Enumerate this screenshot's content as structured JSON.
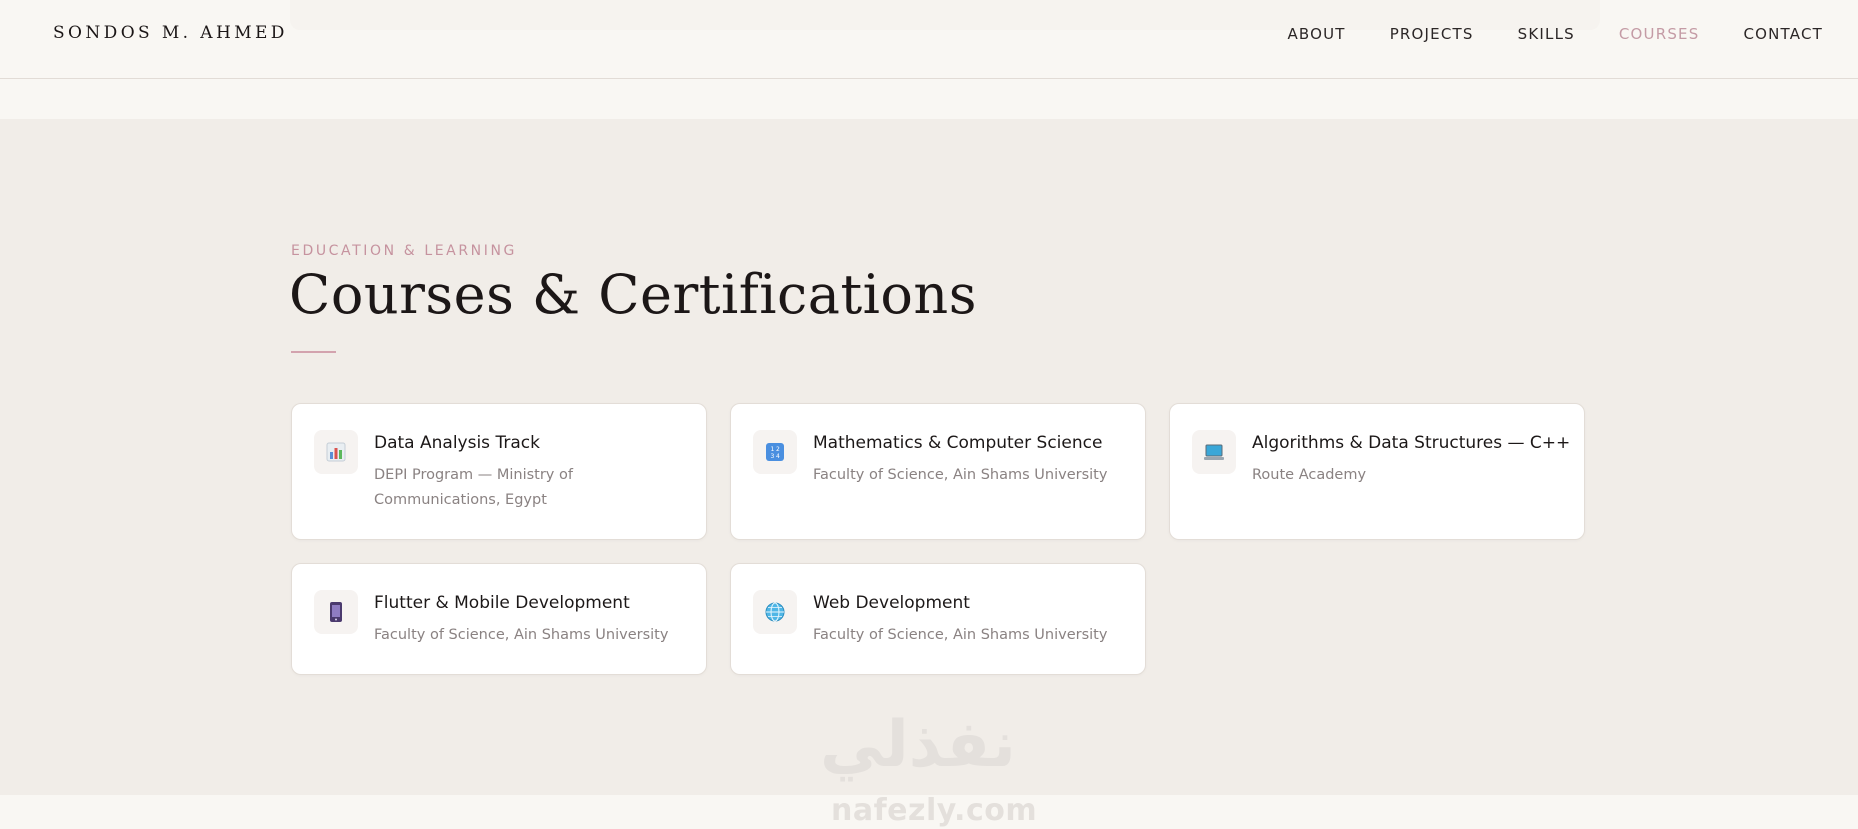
{
  "header": {
    "brand": "SONDOS M. AHMED",
    "nav": [
      {
        "label": "ABOUT",
        "active": false
      },
      {
        "label": "PROJECTS",
        "active": false
      },
      {
        "label": "SKILLS",
        "active": false
      },
      {
        "label": "COURSES",
        "active": true
      },
      {
        "label": "CONTACT",
        "active": false
      }
    ]
  },
  "section": {
    "eyebrow": "EDUCATION & LEARNING",
    "title": "Courses & Certifications"
  },
  "courses": [
    {
      "icon": "bar-chart-icon",
      "title": "Data Analysis Track",
      "subtitle": "DEPI Program — Ministry of Communications, Egypt"
    },
    {
      "icon": "numbers-icon",
      "title": "Mathematics & Computer Science",
      "subtitle": "Faculty of Science, Ain Shams University"
    },
    {
      "icon": "laptop-icon",
      "title": "Algorithms & Data Structures — C++",
      "subtitle": "Route Academy"
    },
    {
      "icon": "mobile-phone-icon",
      "title": "Flutter & Mobile Development",
      "subtitle": "Faculty of Science, Ain Shams University"
    },
    {
      "icon": "globe-icon",
      "title": "Web Development",
      "subtitle": "Faculty of Science, Ain Shams University"
    }
  ],
  "watermark": {
    "arabic": "نفذلي",
    "latin": "nafezly.com"
  },
  "colors": {
    "accent": "#c49ba5",
    "background": "#f9f7f3",
    "section_background": "#f1ede8",
    "card_background": "#ffffff"
  }
}
